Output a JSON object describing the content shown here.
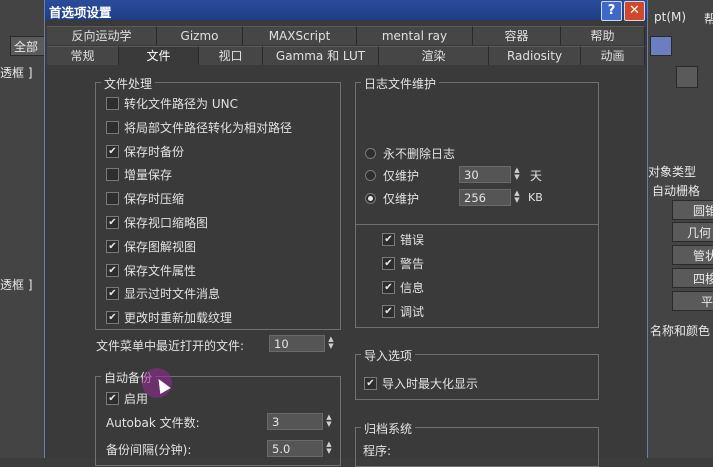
{
  "title": "首选项设置",
  "title_buttons": {
    "help": "?",
    "close": "✕"
  },
  "tabs_row1": [
    "反向运动学",
    "Gizmo",
    "MAXScript",
    "mental ray",
    "容器",
    "帮助"
  ],
  "tabs_row2": [
    "常规",
    "文件",
    "视口",
    "Gamma 和 LUT",
    "渲染",
    "Radiosity",
    "动画"
  ],
  "selected_tab": "文件",
  "file_handling": {
    "label": "文件处理",
    "items": [
      {
        "label": "转化文件路径为 UNC",
        "checked": false
      },
      {
        "label": "将局部文件路径转化为相对路径",
        "checked": false
      },
      {
        "label": "保存时备份",
        "checked": true
      },
      {
        "label": "增量保存",
        "checked": false
      },
      {
        "label": "保存时压缩",
        "checked": false
      },
      {
        "label": "保存视口缩略图",
        "checked": true
      },
      {
        "label": "保存图解视图",
        "checked": true
      },
      {
        "label": "保存文件属性",
        "checked": true
      },
      {
        "label": "显示过时文件消息",
        "checked": true
      },
      {
        "label": "更改时重新加载纹理",
        "checked": true
      }
    ],
    "recent_label": "文件菜单中最近打开的文件:",
    "recent_value": "10"
  },
  "auto_backup": {
    "label": "自动备份",
    "enable_label": "启用",
    "enable_checked": true,
    "count_label": "Autobak 文件数:",
    "count_value": "3",
    "interval_label": "备份间隔(分钟):",
    "interval_value": "5.0"
  },
  "log": {
    "label": "日志文件维护",
    "never_delete": "永不删除日志",
    "keep_days_label": "仅维护",
    "keep_days_value": "30",
    "days_unit": "天",
    "keep_kb_label": "仅维护",
    "keep_kb_value": "256",
    "kb_unit": "KB",
    "selected": "kb",
    "types": [
      {
        "label": "错误",
        "checked": true
      },
      {
        "label": "警告",
        "checked": true
      },
      {
        "label": "信息",
        "checked": true
      },
      {
        "label": "调试",
        "checked": true
      }
    ]
  },
  "import": {
    "label": "导入选项",
    "maximize_label": "导入时最大化显示",
    "maximize_checked": true
  },
  "archive": {
    "label": "归档系统",
    "program_label": "程序:"
  },
  "background": {
    "left_items": [
      "全部",
      "透框 ]",
      "透框 ]"
    ],
    "right_top": "pt(M)",
    "right_top2": "帮",
    "right_items": [
      "对象类型",
      "自动栅格",
      "圆锥",
      "几何",
      "管状",
      "四梭",
      "平",
      "名称和颜色"
    ]
  }
}
